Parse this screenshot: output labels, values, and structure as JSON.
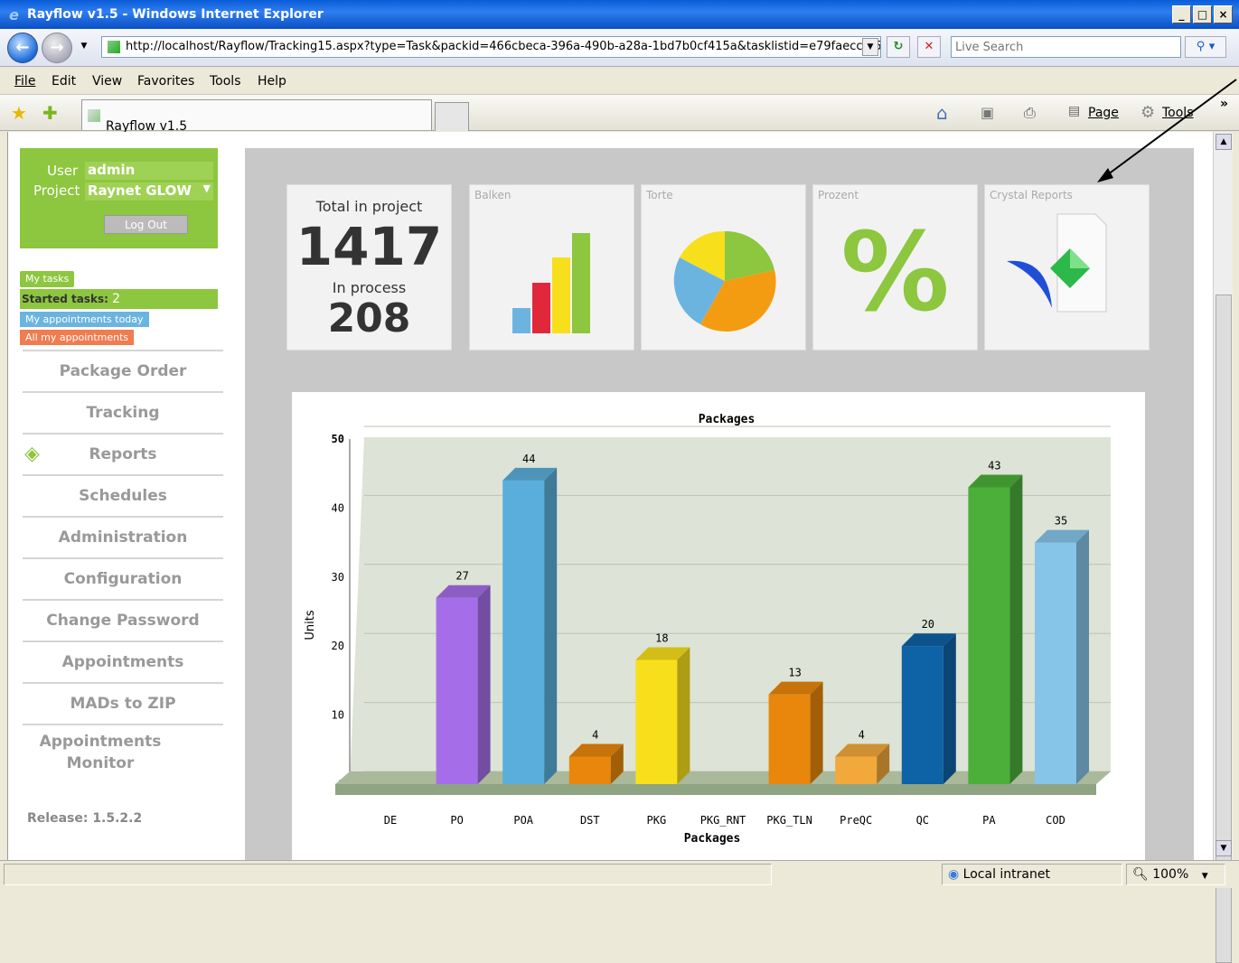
{
  "browser": {
    "window_title": "Rayflow v1.5 - Windows Internet Explorer",
    "url": "http://localhost/Rayflow/Tracking15.aspx?type=Task&packid=466cbeca-396a-490b-a28a-1bd7b0cf415a&tasklistid=e79faecc-65",
    "search_placeholder": "Live Search",
    "menu": [
      "File",
      "Edit",
      "View",
      "Favorites",
      "Tools",
      "Help"
    ],
    "tab_title": "Rayflow v1.5",
    "cmd_page": "Page",
    "cmd_tools": "Tools",
    "overflow": "»",
    "status_zone": "Local intranet",
    "status_zoom": "100%"
  },
  "sidebar": {
    "user_label": "User",
    "user_value": "admin",
    "project_label": "Project",
    "project_value": "Raynet GLOW",
    "logout_label": "Log Out",
    "my_tasks_label": "My tasks",
    "started_tasks_label": "Started tasks:",
    "started_tasks_count": "2",
    "appointments_today_label": "My appointments today",
    "all_appointments_label": "All my appointments",
    "nav": [
      "Package Order",
      "Tracking",
      "Reports",
      "Schedules",
      "Administration",
      "Configuration",
      "Change Password",
      "Appointments",
      "MADs to ZIP",
      "Appointments Monitor"
    ],
    "release": "Release: 1.5.2.2"
  },
  "tiles": {
    "total_label": "Total in project",
    "total_value": "1417",
    "in_process_label": "In process",
    "in_process_value": "208",
    "balken_label": "Balken",
    "torte_label": "Torte",
    "prozent_label": "Prozent",
    "prozent_symbol": "%",
    "crystal_label": "Crystal Reports"
  },
  "colors": {
    "sidebar_green": "#8dc63f",
    "appt_today_blue": "#6cb4e0",
    "all_appt_orange": "#f07c50"
  },
  "chart_data": {
    "type": "bar",
    "title": "Packages",
    "xlabel": "Packages",
    "ylabel": "Units",
    "ylim": [
      0,
      50
    ],
    "yticks": [
      0,
      10,
      20,
      30,
      40,
      50
    ],
    "categories": [
      "DE",
      "PO",
      "POA",
      "DST",
      "PKG",
      "PKG_RNT",
      "PKG_TLN",
      "PreQC",
      "QC",
      "PA",
      "COD"
    ],
    "values": [
      0,
      27,
      44,
      4,
      18,
      0,
      13,
      4,
      20,
      43,
      35
    ],
    "value_labels": [
      "",
      "27",
      "44",
      "4",
      "18",
      "",
      "13",
      "4",
      "20",
      "43",
      "35"
    ],
    "colors": [
      "#999999",
      "#a56ee8",
      "#5aaedb",
      "#e8870c",
      "#f7e01b",
      "#999999",
      "#e8870c",
      "#f2a93b",
      "#0e62a6",
      "#4caf3a",
      "#86c4e8"
    ],
    "grid": true,
    "style": "3d"
  }
}
